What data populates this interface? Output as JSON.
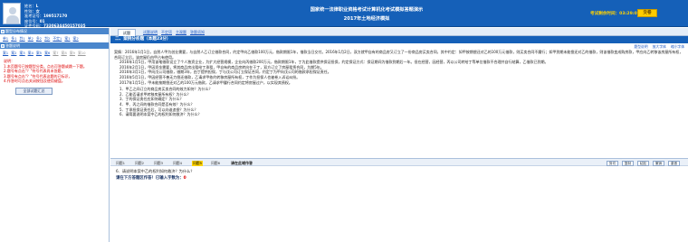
{
  "candidate": {
    "name_label": "姓名：",
    "name_value": "L",
    "gender_label": "性别：",
    "gender_value": "女",
    "exam_no_label": "准考证号：",
    "exam_no_value": "199517170",
    "seat_label": "座位号：",
    "seat_value": "01",
    "id_label": "证件号码：",
    "id_value": "7330634450157035"
  },
  "exam": {
    "title_line1": "国家统一法律职业资格考试计算机化考试模拟答题演示",
    "title_line2": "2017年土地经济模拟",
    "timer_label": "考试剩余时间：",
    "timer_value": "03:29:07",
    "submit_label": "交卷"
  },
  "left_panel": {
    "section1_title": "题型分布情况",
    "section1_links": [
      "单1",
      "多1",
      "判1",
      "单2",
      "多2",
      "判2",
      "不定1",
      "案1",
      "案2"
    ],
    "section2_title": "答题说明",
    "section2_links": [
      "案1",
      "案2",
      "案3",
      "案4",
      "案5",
      "案6",
      "案7",
      "案8",
      "案9",
      "案10"
    ],
    "notes": [
      "说明：",
      "1.本页题号已按题型分类，点击可答题或跳一下题。",
      "2.题号有点击\"？\"符号代表尚未答题，",
      "3.题号有点击\"？\"符号代表这题的已标识，",
      "4.作答时可点击关闭按钮及使用键盘。"
    ],
    "legend_button": "全部试题汇总"
  },
  "tabs": {
    "active": "试题",
    "links": [
      "试题说明",
      "不定项",
      "主观题",
      "答题须知"
    ]
  },
  "section_header": "二、案例分析题（本题23分）",
  "question_tools": [
    "题型说明",
    "放大字体",
    "缩小字体"
  ],
  "question": {
    "paragraphs": [
      "案情：2016年1月1日，自然人甲为创业需要，与自然人乙订立借款合同，约定甲向乙借款100万元，借款期限1年，借款当日交付。2016年1月2日，双方就甲自有的商品房又订立了一份商品房买卖合同，其中约定：如甲按期偿还对乙的100万元借款，则买卖合同不履行；如甲到期未能偿还对乙的借款，则该借款变成购房款，甲应向乙转移该房屋所有权，合同订立后，该房屋仍由甲占有使用。",
      "2016年1月5日，甲用该笔借款设立了个人独资企业，为扩大经营规模，企业向丙借款200万元，借款期限1年，丁为此借款提供保证担保，约定保证方式：保证期间为借款到期后一年。但在经营，因经营，丙以公司转给丁等单位借款不合理并自行结算，乙借款已到期。",
      "2016年2月1日，甲因资金需要，将其商品房出租给丁承租，甲自有的商品房转向在于丁，双方订立了房屋租赁合同，为期5年。",
      "2016年3月1日，甲向戊公司借款，借期3年，由丁提供担保，丁与戊公司订立保证合同，约定丁为甲向戊公司的借款承担保证责任。",
      "2016年5月1日，甲因经营不善无力偿还借款，乙请求甲依约转移房屋所有权，丁作为担保人也被卷入诉讼纠纷。",
      "2017年1月5日，甲未能按期偿还对乙的100万元借款，乙请求甲履行合同约定将房屋过户，以实现其债权。"
    ],
    "items": [
      "1．甲乙之间订立的商品房买卖合同的效力如何？为什么？",
      "2．乙能否请求甲转移房屋所有权？为什么？",
      "3．丁的保证责任应如何确定？为什么？",
      "4．甲、丙之间的借款合同是否有效？为什么？",
      "5．丁承担保证责任后，可以向谁追偿？为什么？",
      "6．请简要说明本案中乙的权利如何救济？为什么？"
    ]
  },
  "answer_toolbar": {
    "buttons": [
      "问题1",
      "问题2",
      "问题3",
      "问题4",
      "问题5",
      "问题6"
    ],
    "active_index": 4,
    "prompt": "请在此域作答",
    "right_buttons": [
      "剪切",
      "复制",
      "粘贴",
      "撤销",
      "重做"
    ]
  },
  "answer": {
    "question": "6．请说明本案中乙的权利如何救济？为什么？",
    "hint_prefix": "请在下方答题区作答！已输入字数为：",
    "hint_count": "0",
    "content": ""
  }
}
